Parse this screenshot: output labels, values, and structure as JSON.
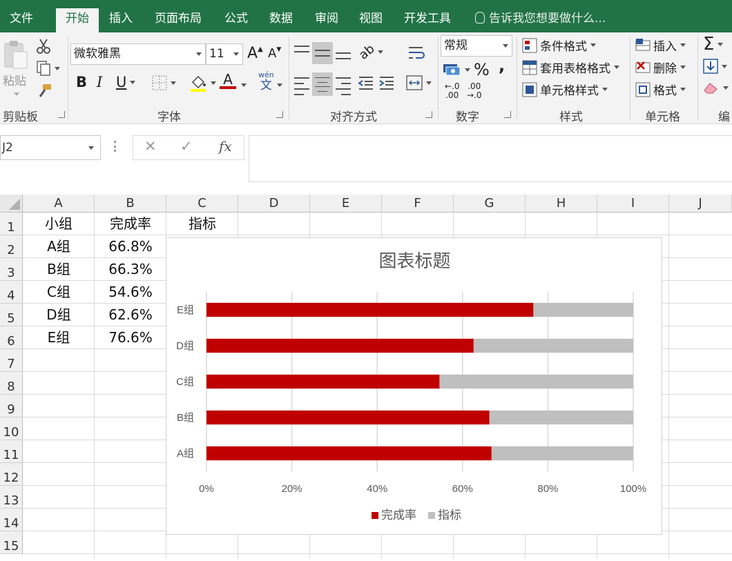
{
  "menu": {
    "tabs": [
      "文件",
      "开始",
      "插入",
      "页面布局",
      "公式",
      "数据",
      "审阅",
      "视图",
      "开发工具"
    ],
    "tell_me": "告诉我您想要做什么..."
  },
  "ribbon": {
    "clipboard": {
      "paste": "粘贴",
      "label": "剪贴板"
    },
    "font": {
      "name": "微软雅黑",
      "size": "11",
      "bold": "B",
      "italic": "I",
      "underline": "U",
      "grow": "A",
      "shrink": "A",
      "color_a": "A",
      "phonetic_top": "wén",
      "phonetic_bottom": "文",
      "label": "字体"
    },
    "alignment": {
      "label": "对齐方式"
    },
    "number": {
      "format": "常规",
      "percent": "%",
      "comma": ",",
      "inc_top": "←.0",
      "inc_bottom": ".00",
      "dec_top": ".00",
      "dec_bottom": "→.0",
      "label": "数字"
    },
    "styles": {
      "conditional": "条件格式",
      "table": "套用表格格式",
      "cell": "单元格样式",
      "label": "样式"
    },
    "cells": {
      "insert": "插入",
      "delete": "删除",
      "format": "格式",
      "label": "单元格"
    },
    "editing": {
      "sum": "Σ",
      "label": "编"
    }
  },
  "formula_bar": {
    "name_box": "J2",
    "fx": "fx",
    "cancel": "✕",
    "enter": "✓"
  },
  "columns": [
    "A",
    "B",
    "C",
    "D",
    "E",
    "F",
    "G",
    "H",
    "I",
    "J"
  ],
  "rows": [
    "1",
    "2",
    "3",
    "4",
    "5",
    "6",
    "7",
    "8",
    "9",
    "10",
    "11",
    "12",
    "13",
    "14",
    "15"
  ],
  "table": {
    "headers": [
      "小组",
      "完成率",
      "指标"
    ],
    "rows": [
      [
        "A组",
        "66.8%"
      ],
      [
        "B组",
        "66.3%"
      ],
      [
        "C组",
        "54.6%"
      ],
      [
        "D组",
        "62.6%"
      ],
      [
        "E组",
        "76.6%"
      ]
    ]
  },
  "chart_data": {
    "type": "bar",
    "stacked": "percent",
    "title": "图表标题",
    "categories": [
      "A组",
      "B组",
      "C组",
      "D组",
      "E组"
    ],
    "series": [
      {
        "name": "完成率",
        "values": [
          66.8,
          66.3,
          54.6,
          62.6,
          76.6
        ],
        "color": "#c00000"
      },
      {
        "name": "指标",
        "values": [
          33.2,
          33.7,
          45.4,
          37.4,
          23.4
        ],
        "color": "#bfbfbf"
      }
    ],
    "xticks": [
      "0%",
      "20%",
      "40%",
      "60%",
      "80%",
      "100%"
    ],
    "xlim": [
      0,
      100
    ],
    "grid": true,
    "legend": "bottom"
  },
  "colors": {
    "accent": "#217346",
    "bar_primary": "#c00000",
    "bar_secondary": "#bfbfbf"
  }
}
